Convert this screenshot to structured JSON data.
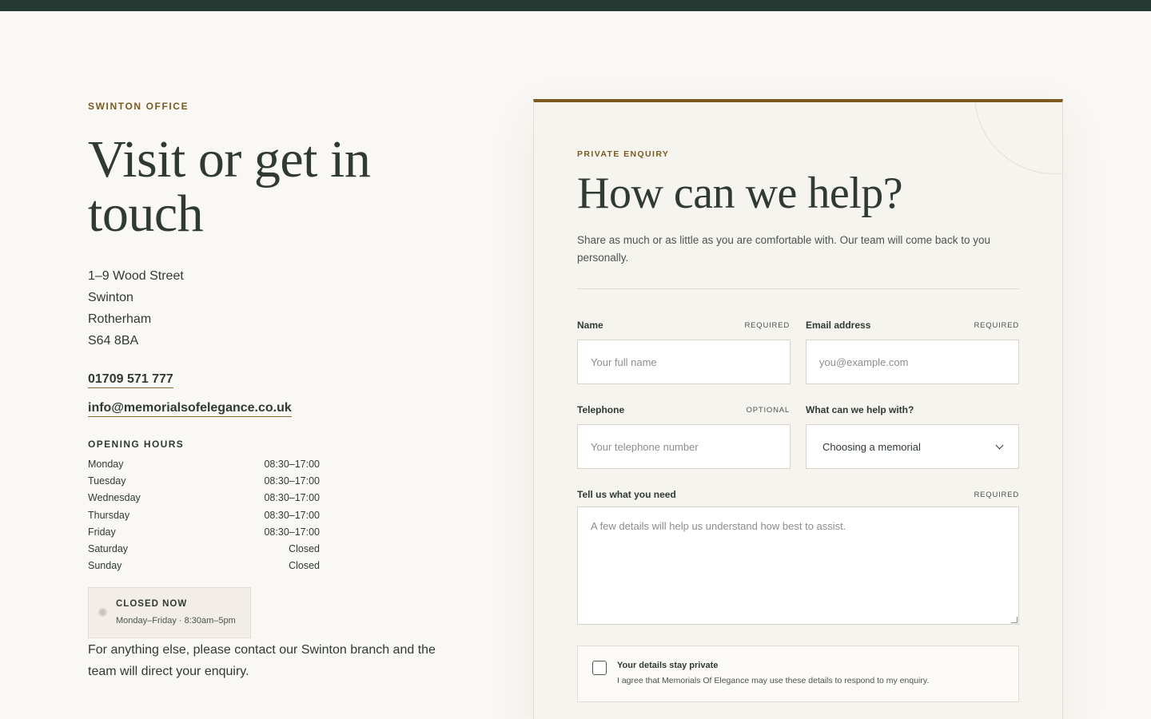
{
  "office": {
    "eyebrow": "SWINTON OFFICE",
    "title": "Visit or get in touch",
    "address": [
      "1–9 Wood Street",
      "Swinton",
      "Rotherham",
      "S64 8BA"
    ],
    "phone": "01709 571 777",
    "email": "info@memorialsofelegance.co.uk",
    "hours_title": "OPENING HOURS",
    "hours": [
      {
        "day": "Monday",
        "time": "08:30–17:00"
      },
      {
        "day": "Tuesday",
        "time": "08:30–17:00"
      },
      {
        "day": "Wednesday",
        "time": "08:30–17:00"
      },
      {
        "day": "Thursday",
        "time": "08:30–17:00"
      },
      {
        "day": "Friday",
        "time": "08:30–17:00"
      },
      {
        "day": "Saturday",
        "time": "Closed"
      },
      {
        "day": "Sunday",
        "time": "Closed"
      }
    ],
    "status": {
      "label": "CLOSED NOW",
      "detail": "Monday–Friday · 8:30am–5pm"
    },
    "footnote": "For anything else, please contact our Swinton branch and the team will direct your enquiry."
  },
  "form": {
    "eyebrow": "PRIVATE ENQUIRY",
    "title": "How can we help?",
    "intro": "Share as much or as little as you are comfortable with. Our team will come back to you personally.",
    "name": {
      "label": "Name",
      "tag": "REQUIRED",
      "placeholder": "Your full name"
    },
    "email": {
      "label": "Email address",
      "tag": "REQUIRED",
      "placeholder": "you@example.com"
    },
    "telephone": {
      "label": "Telephone",
      "tag": "OPTIONAL",
      "placeholder": "Your telephone number"
    },
    "topic": {
      "label": "What can we help with?",
      "selected": "Choosing a memorial"
    },
    "message": {
      "label": "Tell us what you need",
      "tag": "REQUIRED",
      "placeholder": "A few details will help us understand how best to assist."
    },
    "consent": {
      "title": "Your details stay private",
      "text": "I agree that Memorials Of Elegance may use these details to respond to my enquiry."
    }
  },
  "colors": {
    "accent": "#7a5a1e",
    "topbar": "#253a33",
    "background": "#faf8f4",
    "text": "#2f3a34"
  }
}
